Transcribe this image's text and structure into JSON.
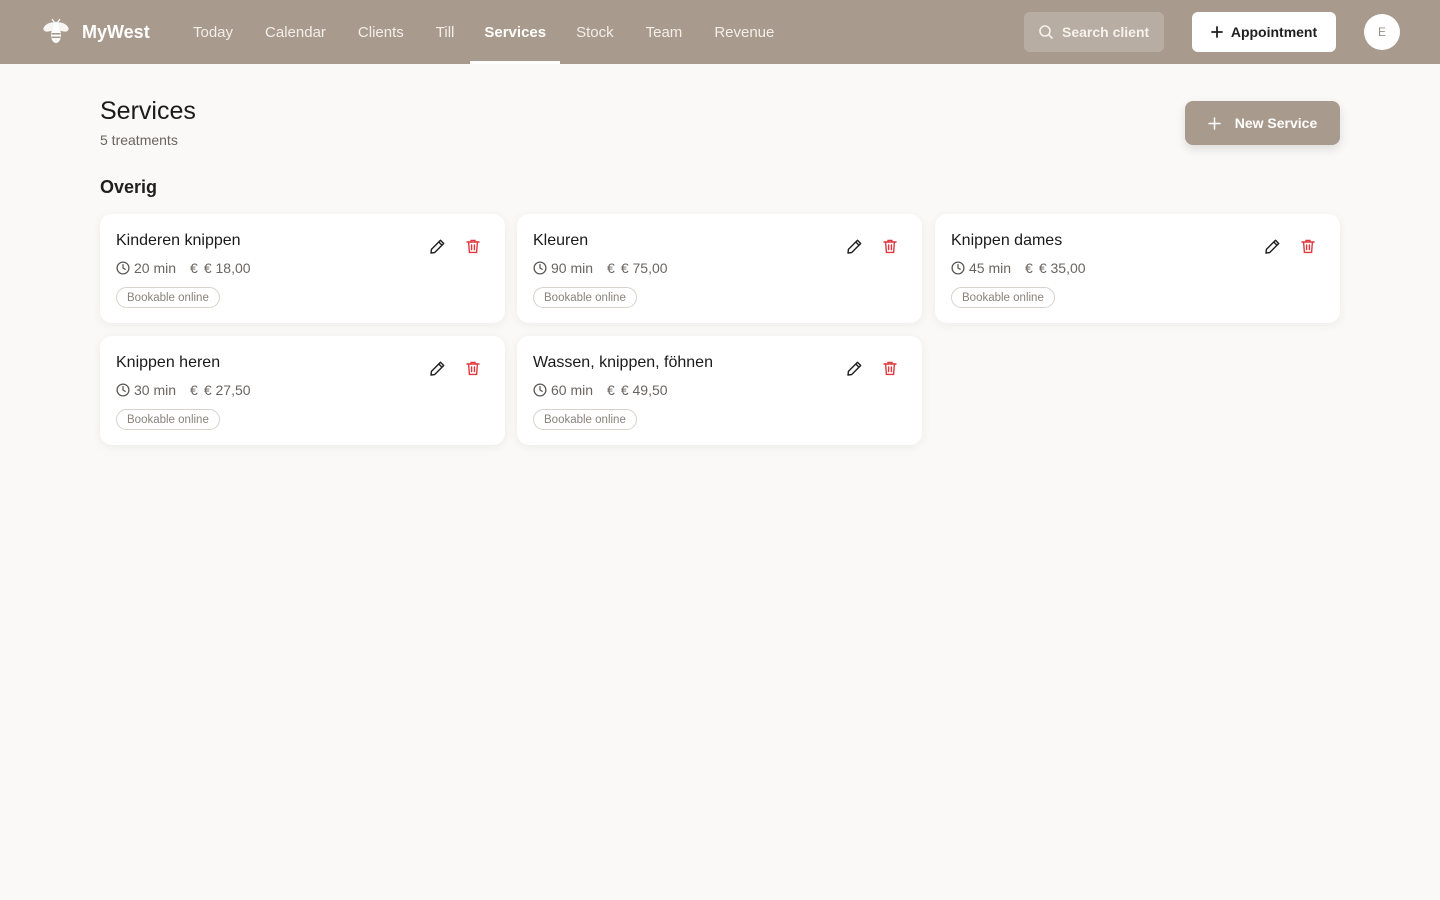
{
  "app": {
    "brand": "MyWest",
    "nav": [
      {
        "label": "Today"
      },
      {
        "label": "Calendar"
      },
      {
        "label": "Clients"
      },
      {
        "label": "Till"
      },
      {
        "label": "Services",
        "active": true
      },
      {
        "label": "Stock"
      },
      {
        "label": "Team"
      },
      {
        "label": "Revenue"
      }
    ],
    "search_label": "Search client",
    "appointment_label": "Appointment",
    "avatar_initial": "E"
  },
  "page": {
    "title": "Services",
    "subtitle": "5 treatments",
    "new_service_label": "New Service",
    "section_title": "Overig"
  },
  "services": [
    {
      "name": "Kinderen knippen",
      "duration": "20 min",
      "currency": "€",
      "price": "€ 18,00",
      "badge": "Bookable online"
    },
    {
      "name": "Kleuren",
      "duration": "90 min",
      "currency": "€",
      "price": "€ 75,00",
      "badge": "Bookable online"
    },
    {
      "name": "Knippen dames",
      "duration": "45 min",
      "currency": "€",
      "price": "€ 35,00",
      "badge": "Bookable online"
    },
    {
      "name": "Knippen heren",
      "duration": "30 min",
      "currency": "€",
      "price": "€ 27,50",
      "badge": "Bookable online"
    },
    {
      "name": "Wassen, knippen, föhnen",
      "duration": "60 min",
      "currency": "€",
      "price": "€ 49,50",
      "badge": "Bookable online"
    }
  ],
  "colors": {
    "accent": "#a89a8c",
    "background": "#faf9f7",
    "delete": "#e0383e"
  }
}
